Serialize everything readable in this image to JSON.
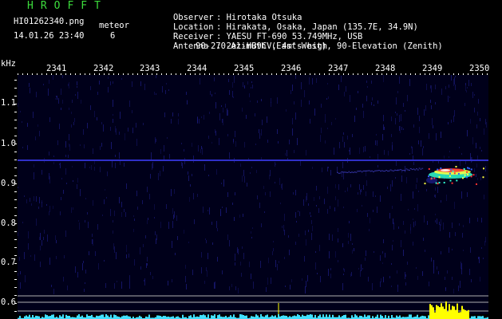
{
  "header": {
    "app_name": "HROFFT",
    "file_name": "HI01262340.png",
    "timestamp": "14.01.26 23:40",
    "meteor_label": "meteor",
    "meteor_count": "6"
  },
  "station": {
    "observer_label": "Observer",
    "observer": "Hirotaka Otsuka",
    "location_label": "Location",
    "location": "Hirakata, Osaka, Japan (135.7E, 34.9N)",
    "receiver_label": "Receiver",
    "receiver": "YAESU FT-690 53.749MHz, USB",
    "antenna_label": "Antenna",
    "antenna_line1": "2el-HB9CV, 4m's high",
    "antenna_line2": "90-270-Azimuth (East-West), 90-Elevation (Zenith)"
  },
  "axes": {
    "y_unit": "kHz",
    "y_ticks": [
      "1.1",
      "1.0",
      "0.9",
      "0.8",
      "0.7",
      "0.6"
    ],
    "x_ticks": [
      "2341",
      "2342",
      "2343",
      "2344",
      "2345",
      "2346",
      "2347",
      "2348",
      "2349",
      "2350"
    ]
  },
  "colors": {
    "background": "#000000",
    "plot_background": "#00001a",
    "noise": "#1a1a7a",
    "carrier": "#3030c8",
    "echo_hot": "#ff3030",
    "echo_warm": "#ffff40",
    "echo_cool": "#30ffd0",
    "amplitude": "#40e0ff",
    "burst": "#ffff00",
    "title_green": "#3cdc3c"
  }
}
